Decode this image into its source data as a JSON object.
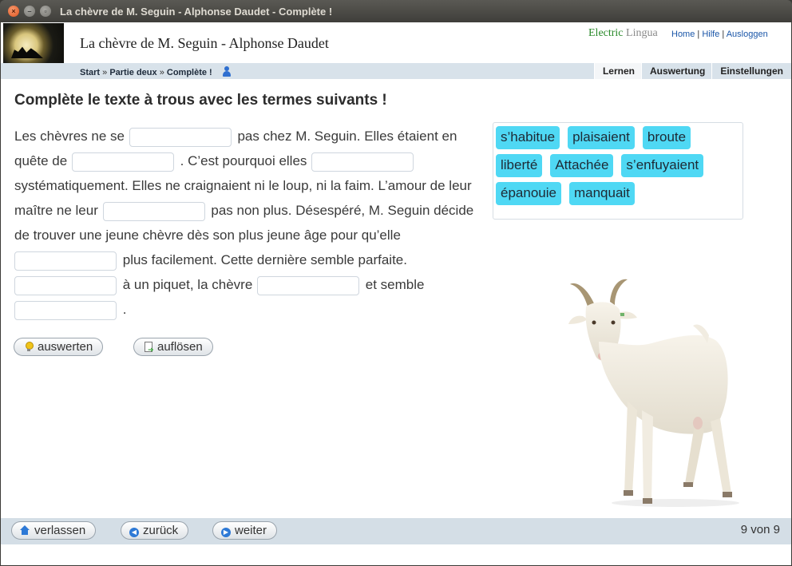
{
  "window": {
    "title": "La chèvre de M. Seguin - Alphonse Daudet - Complète !"
  },
  "header": {
    "logo_text": "LA CHÈVRE DE MONSIEUR SEGUIN",
    "app_title": "La chèvre de M. Seguin - Alphonse Daudet",
    "brand_part1": "Electric",
    "brand_part2": "Lingua",
    "links": {
      "home": "Home",
      "help": "Hilfe",
      "logout": "Ausloggen",
      "sep": "|"
    }
  },
  "breadcrumb": {
    "start": "Start",
    "sep": "»",
    "part": "Partie deux",
    "current": "Complète !"
  },
  "tabs": [
    "Lernen",
    "Auswertung",
    "Einstellungen"
  ],
  "exercise": {
    "instruction": "Complète le texte à trous avec les termes suivants !",
    "segments": [
      "Les chèvres ne se",
      "pas chez M. Seguin. Elles étaient en quête de",
      ". C’est pourquoi elles",
      "systématiquement. Elles ne craignaient ni le loup, ni la faim. L’amour de leur maître ne leur",
      "pas non plus. Désespéré, M. Seguin décide de trouver une jeune chèvre dès son plus jeune âge pour qu’elle",
      "plus facilement. Cette dernière semble parfaite.",
      "à un piquet, la chèvre",
      "et semble",
      "."
    ],
    "gap_values": [
      "",
      "",
      "",
      "",
      "",
      "",
      "",
      ""
    ],
    "word_bank": [
      "s’habitue",
      "plaisaient",
      "broute",
      "liberté",
      "Attachée",
      "s’enfuyaient",
      "épanouie",
      "manquait"
    ],
    "buttons": {
      "check": "auswerten",
      "solve": "auflösen"
    }
  },
  "footer": {
    "leave": "verlassen",
    "back": "zurück",
    "next": "weiter",
    "pager": "9 von 9"
  }
}
